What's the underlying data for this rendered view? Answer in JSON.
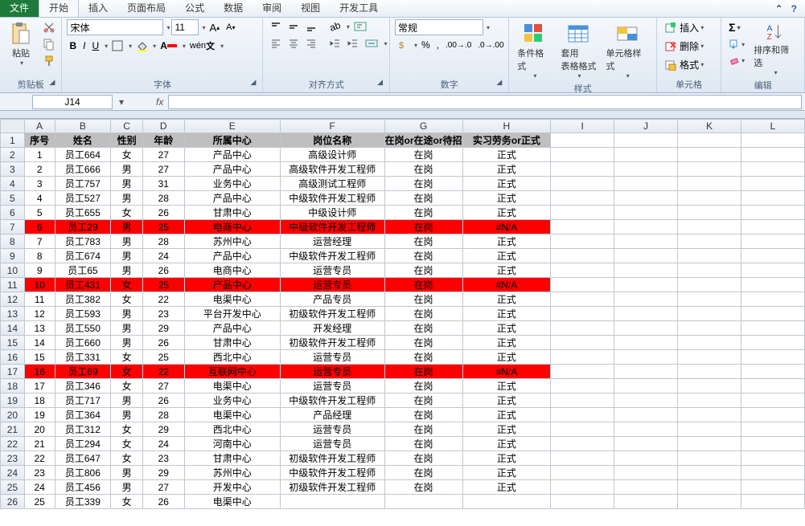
{
  "tabs": {
    "file": "文件",
    "items": [
      "开始",
      "插入",
      "页面布局",
      "公式",
      "数据",
      "审阅",
      "视图",
      "开发工具"
    ],
    "active_index": 0
  },
  "ribbon": {
    "clipboard": {
      "label": "剪贴板",
      "paste": "粘贴"
    },
    "font": {
      "label": "字体",
      "name": "宋体",
      "size": "11",
      "bold": "B",
      "italic": "I",
      "underline": "U"
    },
    "align": {
      "label": "对齐方式"
    },
    "number": {
      "label": "数字",
      "format": "常规"
    },
    "styles": {
      "label": "样式",
      "cond": "条件格式",
      "tbl": "套用\n表格格式",
      "cell": "单元格样式"
    },
    "cells": {
      "label": "单元格",
      "insert": "插入",
      "delete": "删除",
      "format": "格式"
    },
    "editing": {
      "label": "编辑",
      "sort": "排序和筛选"
    }
  },
  "namebox": "J14",
  "formula": "",
  "columns": [
    "A",
    "B",
    "C",
    "D",
    "E",
    "F",
    "G",
    "H",
    "I",
    "J",
    "K",
    "L"
  ],
  "headers": [
    "序号",
    "姓名",
    "性别",
    "年龄",
    "所属中心",
    "岗位名称",
    "在岗or在途or待招",
    "实习劳务or正式"
  ],
  "rows": [
    {
      "n": 1,
      "r": [
        "1",
        "员工664",
        "女",
        "27",
        "产品中心",
        "高级设计师",
        "在岗",
        "正式"
      ],
      "red": false
    },
    {
      "n": 2,
      "r": [
        "2",
        "员工666",
        "男",
        "27",
        "产品中心",
        "高级软件开发工程师",
        "在岗",
        "正式"
      ],
      "red": false
    },
    {
      "n": 3,
      "r": [
        "3",
        "员工757",
        "男",
        "31",
        "业务中心",
        "高级测试工程师",
        "在岗",
        "正式"
      ],
      "red": false
    },
    {
      "n": 4,
      "r": [
        "4",
        "员工527",
        "男",
        "28",
        "产品中心",
        "中级软件开发工程师",
        "在岗",
        "正式"
      ],
      "red": false
    },
    {
      "n": 5,
      "r": [
        "5",
        "员工655",
        "女",
        "26",
        "甘肃中心",
        "中级设计师",
        "在岗",
        "正式"
      ],
      "red": false
    },
    {
      "n": 6,
      "r": [
        "6",
        "员工29",
        "男",
        "25",
        "电商中心",
        "中级软件开发工程师",
        "在岗",
        "#N/A"
      ],
      "red": true
    },
    {
      "n": 7,
      "r": [
        "7",
        "员工783",
        "男",
        "28",
        "苏州中心",
        "运营经理",
        "在岗",
        "正式"
      ],
      "red": false
    },
    {
      "n": 8,
      "r": [
        "8",
        "员工674",
        "男",
        "24",
        "产品中心",
        "中级软件开发工程师",
        "在岗",
        "正式"
      ],
      "red": false
    },
    {
      "n": 9,
      "r": [
        "9",
        "员工65",
        "男",
        "26",
        "电商中心",
        "运营专员",
        "在岗",
        "正式"
      ],
      "red": false
    },
    {
      "n": 10,
      "r": [
        "10",
        "员工431",
        "女",
        "25",
        "产品中心",
        "运营专员",
        "在岗",
        "#N/A"
      ],
      "red": true
    },
    {
      "n": 11,
      "r": [
        "11",
        "员工382",
        "女",
        "22",
        "电渠中心",
        "产品专员",
        "在岗",
        "正式"
      ],
      "red": false
    },
    {
      "n": 12,
      "r": [
        "12",
        "员工593",
        "男",
        "23",
        "平台开发中心",
        "初级软件开发工程师",
        "在岗",
        "正式"
      ],
      "red": false
    },
    {
      "n": 13,
      "r": [
        "13",
        "员工550",
        "男",
        "29",
        "产品中心",
        "开发经理",
        "在岗",
        "正式"
      ],
      "red": false
    },
    {
      "n": 14,
      "r": [
        "14",
        "员工660",
        "男",
        "26",
        "甘肃中心",
        "初级软件开发工程师",
        "在岗",
        "正式"
      ],
      "red": false
    },
    {
      "n": 15,
      "r": [
        "15",
        "员工331",
        "女",
        "25",
        "西北中心",
        "运营专员",
        "在岗",
        "正式"
      ],
      "red": false
    },
    {
      "n": 16,
      "r": [
        "16",
        "员工69",
        "女",
        "22",
        "互联网中心",
        "运营专员",
        "在岗",
        "#N/A"
      ],
      "red": true
    },
    {
      "n": 17,
      "r": [
        "17",
        "员工346",
        "女",
        "27",
        "电渠中心",
        "运营专员",
        "在岗",
        "正式"
      ],
      "red": false
    },
    {
      "n": 18,
      "r": [
        "18",
        "员工717",
        "男",
        "26",
        "业务中心",
        "中级软件开发工程师",
        "在岗",
        "正式"
      ],
      "red": false
    },
    {
      "n": 19,
      "r": [
        "19",
        "员工364",
        "男",
        "28",
        "电渠中心",
        "产品经理",
        "在岗",
        "正式"
      ],
      "red": false
    },
    {
      "n": 20,
      "r": [
        "20",
        "员工312",
        "女",
        "29",
        "西北中心",
        "运营专员",
        "在岗",
        "正式"
      ],
      "red": false
    },
    {
      "n": 21,
      "r": [
        "21",
        "员工294",
        "女",
        "24",
        "河南中心",
        "运营专员",
        "在岗",
        "正式"
      ],
      "red": false
    },
    {
      "n": 22,
      "r": [
        "22",
        "员工647",
        "女",
        "23",
        "甘肃中心",
        "初级软件开发工程师",
        "在岗",
        "正式"
      ],
      "red": false
    },
    {
      "n": 23,
      "r": [
        "23",
        "员工806",
        "男",
        "29",
        "苏州中心",
        "中级软件开发工程师",
        "在岗",
        "正式"
      ],
      "red": false
    },
    {
      "n": 24,
      "r": [
        "24",
        "员工456",
        "男",
        "27",
        "开发中心",
        "初级软件开发工程师",
        "在岗",
        "正式"
      ],
      "red": false
    },
    {
      "n": 25,
      "r": [
        "25",
        "员工339",
        "女",
        "26",
        "电渠中心",
        "",
        "",
        ""
      ],
      "red": false
    }
  ]
}
